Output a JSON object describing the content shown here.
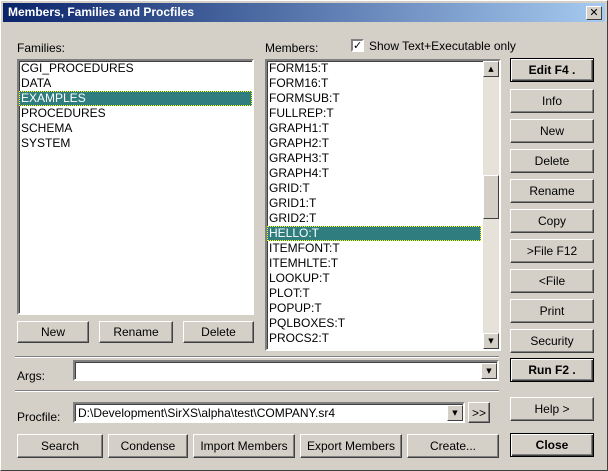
{
  "window": {
    "title": "Members, Families and Procfiles",
    "close_glyph": "✕"
  },
  "families": {
    "label": "Families:",
    "items": [
      "CGI_PROCEDURES",
      "DATA",
      "EXAMPLES",
      "PROCEDURES",
      "SCHEMA",
      "SYSTEM"
    ],
    "selected_index": 2,
    "buttons": {
      "new": "New",
      "rename": "Rename",
      "delete": "Delete"
    }
  },
  "members": {
    "label": "Members:",
    "show_text_label": "Show Text+Executable only",
    "show_text_checked": true,
    "items": [
      "FORM15:T",
      "FORM16:T",
      "FORMSUB:T",
      "FULLREP:T",
      "GRAPH1:T",
      "GRAPH2:T",
      "GRAPH3:T",
      "GRAPH4:T",
      "GRID:T",
      "GRID1:T",
      "GRID2:T",
      "HELLO:T",
      "ITEMFONT:T",
      "ITEMHLTE:T",
      "LOOKUP:T",
      "PLOT:T",
      "POPUP:T",
      "PQLBOXES:T",
      "PROCS2:T"
    ],
    "selected_index": 11
  },
  "side_buttons": {
    "edit": "Edit F4   .",
    "info": "Info",
    "new": "New",
    "delete": "Delete",
    "rename": "Rename",
    "copy": "Copy",
    "file_out": ">File F12",
    "file_in": "<File",
    "print": "Print",
    "security": "Security",
    "run": "Run F2   .",
    "help": "Help >",
    "close": "Close"
  },
  "args": {
    "label": "Args:",
    "value": ""
  },
  "procfile": {
    "label": "Procfile:",
    "value": "D:\\Development\\SirXS\\alpha\\test\\COMPANY.sr4",
    "more_label": ">>"
  },
  "bottom_buttons": {
    "search": "Search",
    "condense": "Condense",
    "import": "Import Members",
    "export": "Export Members",
    "create": "Create..."
  }
}
